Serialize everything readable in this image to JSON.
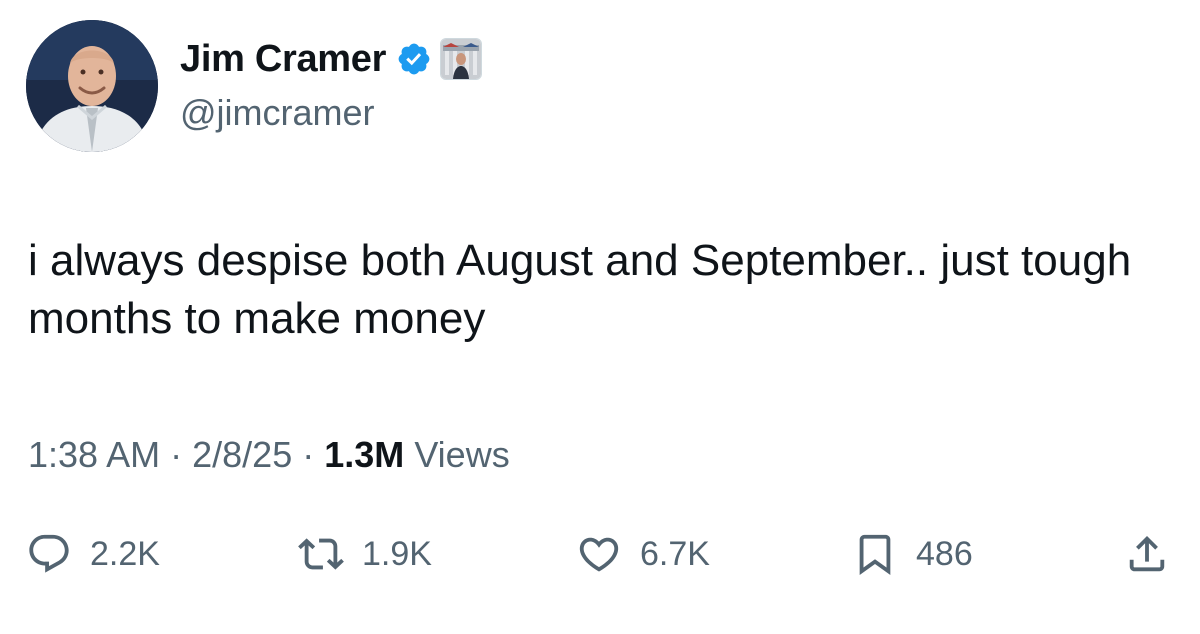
{
  "author": {
    "display_name": "Jim Cramer",
    "handle": "@jimcramer",
    "avatar_icon": "profile-photo",
    "verified_icon": "verified-badge-icon",
    "affiliate_icon": "affiliate-badge-icon"
  },
  "tweet": {
    "text": "i always despise both August and September.. just tough months to make money"
  },
  "meta": {
    "time": "1:38 AM",
    "separator": "·",
    "date": "2/8/25",
    "views_count": "1.3M",
    "views_label": "Views"
  },
  "actions": {
    "reply": {
      "icon": "reply-icon",
      "count": "2.2K"
    },
    "repost": {
      "icon": "repost-icon",
      "count": "1.9K"
    },
    "like": {
      "icon": "heart-icon",
      "count": "6.7K"
    },
    "bookmark": {
      "icon": "bookmark-icon",
      "count": "486"
    },
    "share": {
      "icon": "share-icon"
    }
  },
  "colors": {
    "text_primary": "#0f1419",
    "text_secondary": "#536471",
    "verified_blue": "#1d9bf0",
    "background": "#ffffff"
  }
}
